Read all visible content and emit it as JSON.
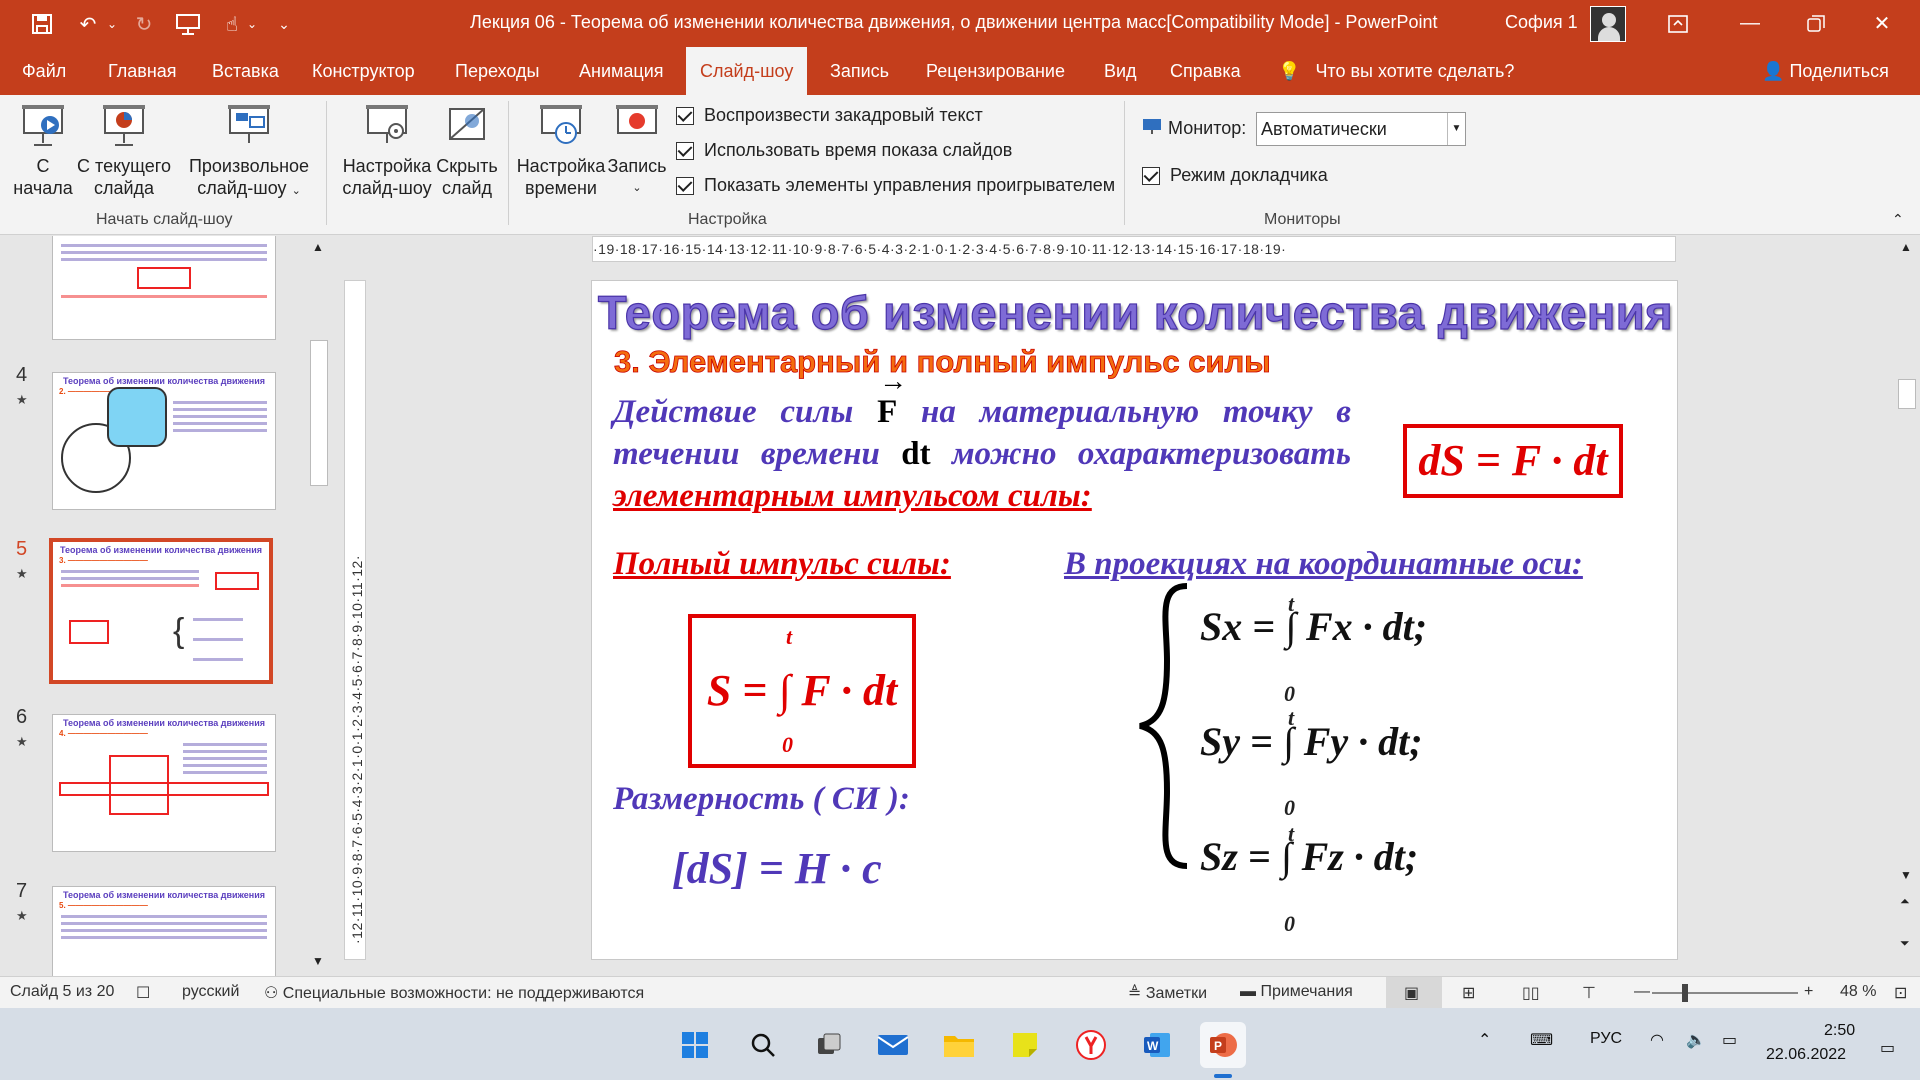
{
  "window": {
    "title": "Лекция 06 - Теорема об изменении количества движения, о движении центра масс[Compatibility Mode]  -  PowerPoint",
    "user": "София 1"
  },
  "tabs": [
    {
      "label": "Файл"
    },
    {
      "label": "Главная"
    },
    {
      "label": "Вставка"
    },
    {
      "label": "Конструктор"
    },
    {
      "label": "Переходы"
    },
    {
      "label": "Анимация"
    },
    {
      "label": "Слайд-шоу"
    },
    {
      "label": "Запись"
    },
    {
      "label": "Рецензирование"
    },
    {
      "label": "Вид"
    },
    {
      "label": "Справка"
    }
  ],
  "tell_me": "Что вы хотите сделать?",
  "share": "Поделиться",
  "ribbon": {
    "start": {
      "from_start_1": "С",
      "from_start_2": "начала",
      "from_current_1": "С текущего",
      "from_current_2": "слайда",
      "custom_1": "Произвольное",
      "custom_2": "слайд-шоу",
      "label": "Начать слайд-шоу"
    },
    "setup": {
      "setup_1": "Настройка",
      "setup_2": "слайд-шоу",
      "hide_1": "Скрыть",
      "hide_2": "слайд",
      "timing_1": "Настройка",
      "timing_2": "времени",
      "record": "Запись",
      "chk_narration": "Воспроизвести закадровый текст",
      "chk_timings": "Использовать время показа слайдов",
      "chk_controls": "Показать элементы управления проигрывателем",
      "label": "Настройка"
    },
    "monitors": {
      "monitor_label": "Монитор:",
      "monitor_value": "Автоматически",
      "presenter": "Режим докладчика",
      "label": "Мониторы"
    }
  },
  "ruler": "·19·18·17·16·15·14·13·12·11·10·9·8·7·6·5·4·3·2·1·0·1·2·3·4·5·6·7·8·9·10·11·12·13·14·15·16·17·18·19·",
  "vruler": "·12·11·10·9·8·7·6·5·4·3·2·1·0·1·2·3·4·5·6·7·8·9·10·11·12·",
  "thumbnails": [
    {
      "num": "4",
      "title": "Теорема об изменении количества движения"
    },
    {
      "num": "5",
      "title": "Теорема об изменении количества движения"
    },
    {
      "num": "6",
      "title": "Теорема об изменении количества движения"
    },
    {
      "num": "7",
      "title": "Теорема об изменении количества движения"
    }
  ],
  "slide": {
    "title": "Теорема об изменении количества движения",
    "subtitle": "3. Элементарный и полный импульс силы",
    "body_1": "Действие силы",
    "body_F": "F",
    "body_2": "на материальную точку в",
    "body_3": "течении времени",
    "body_dt": "dt",
    "body_4": "можно охарактеризовать",
    "body_5": "элементарным импульсом силы:",
    "formula_dS": "dS = F · dt",
    "heading_full": "Полный импульс силы:",
    "heading_proj": "В проекциях на координатные оси:",
    "formula_S": "S = ∫ F · dt",
    "limit_top": "t",
    "limit_bottom": "0",
    "dim_label": "Размерность ( СИ ):",
    "dim_formula": "[dS] = H · c",
    "sx": "Sx = ∫ Fx · dt;",
    "sy": "Sy = ∫ Fy · dt;",
    "sz": "Sz = ∫ Fz · dt;"
  },
  "status": {
    "slide": "Слайд 5 из 20",
    "lang": "русский",
    "accessibility": "Специальные возможности: не поддерживаются",
    "notes": "Заметки",
    "comments": "Примечания",
    "zoom": "48 %"
  },
  "taskbar": {
    "lang": "РУС",
    "time": "2:50",
    "date": "22.06.2022"
  },
  "colors": {
    "accent": "#c43e1c",
    "slide_blue": "#5038b8",
    "slide_red": "#e00000",
    "slide_orange": "#f46c0f"
  }
}
